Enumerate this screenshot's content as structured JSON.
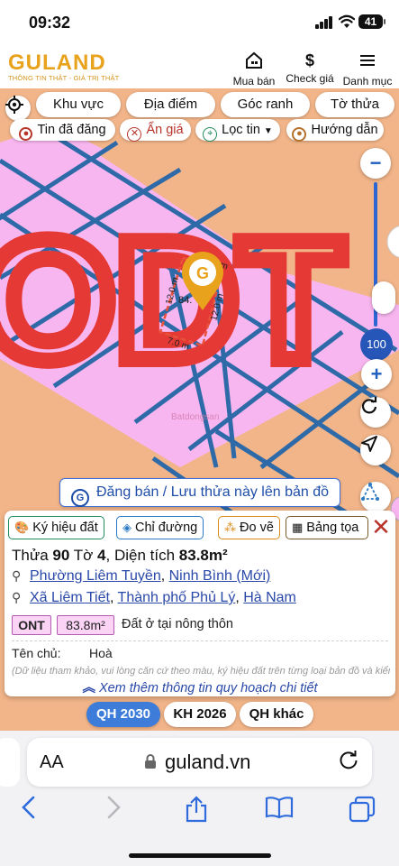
{
  "status": {
    "time": "09:32",
    "battery": "41"
  },
  "header": {
    "logo": "GULAND",
    "logo_sub": "THÔNG TIN THẬT - GIÁ TRỊ THẬT",
    "buttons": [
      {
        "label": "Mua bán",
        "icon": "house-icon"
      },
      {
        "label": "Check giá",
        "icon": "dollar-icon",
        "glyph": "$"
      },
      {
        "label": "Danh mục",
        "icon": "menu-icon"
      }
    ]
  },
  "filters": {
    "row1": [
      "Khu vực",
      "Địa điểm",
      "Góc ranh",
      "Tờ thửa"
    ],
    "row2": [
      {
        "label": "Tin đã đăng",
        "icon": "pin-icon"
      },
      {
        "label": "Ẩn giá",
        "icon": "hide-icon"
      },
      {
        "label": "Lọc tin",
        "icon": "location-filter-icon"
      },
      {
        "label": "Hướng dẫn",
        "icon": "guide-icon"
      }
    ]
  },
  "map": {
    "zone_label": "ODT",
    "parcel_area_label": "84.",
    "edges": [
      "12.0 m",
      "12.0 m",
      "7.0 m",
      "7.0 m"
    ],
    "zoom_level": "100",
    "watermark": "Batdongsan",
    "post_banner": "Đăng bán / Lưu thửa này lên bản đồ",
    "colors": {
      "residential": "#f8b6f0",
      "background": "#f2b589",
      "grid": "#2f6aa8",
      "label_red": "#e53935"
    }
  },
  "panel": {
    "actions": [
      {
        "label": "Ký hiệu đất",
        "icon": "palette-icon"
      },
      {
        "label": "Chỉ đường",
        "icon": "directions-icon"
      },
      {
        "label": "Đo vẽ",
        "icon": "measure-icon"
      },
      {
        "label": "Bảng tọa",
        "icon": "table-icon"
      }
    ],
    "title": {
      "thua_label": "Thửa",
      "thua": "90",
      "to_label": "Tờ",
      "to": "4",
      "dien_tich_label": ", Diện tích",
      "dien_tich": "83.8m²"
    },
    "address_new": {
      "ward": "Phường Liêm Tuyền",
      "separator": ", ",
      "province": "Ninh Bình (Mới)"
    },
    "address_old": {
      "commune": "Xã Liêm Tiết",
      "city": "Thành phố Phủ Lý",
      "province": "Hà Nam"
    },
    "land_code": "ONT",
    "land_area": "83.8m²",
    "land_type": "Đất ở tại nông thôn",
    "owner_label": "Tên chủ:",
    "owner": "Hoà",
    "disclaimer": "(Dữ liệu tham khảo, vui lòng căn cứ theo màu, ký hiệu đất trên từng loại bản đồ và kiểm tra tại với cơ quan chức năng)",
    "more": "Xem thêm thông tin quy hoạch chi tiết"
  },
  "plan_tabs": [
    "QH 2030",
    "KH 2026",
    "QH khác"
  ],
  "browser": {
    "aa": "AA",
    "url": "guland.vn"
  }
}
